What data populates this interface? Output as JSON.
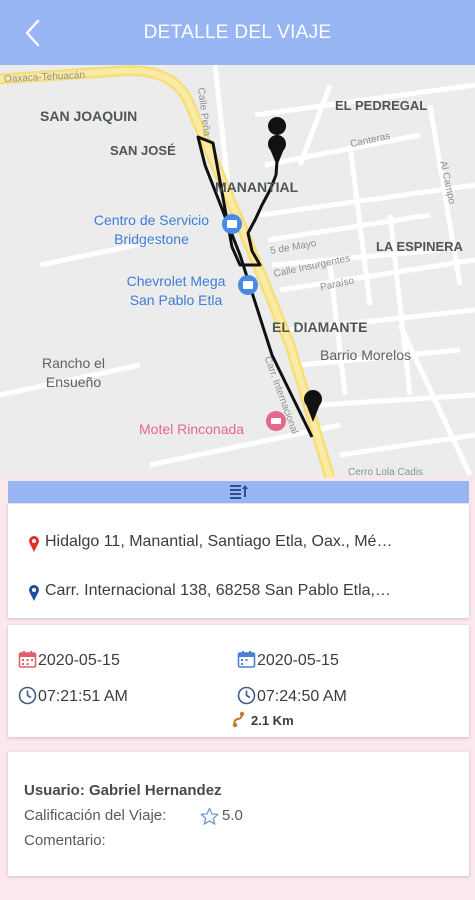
{
  "header": {
    "title": "DETALLE DEL VIAJE"
  },
  "map": {
    "areas": [
      "SAN JOAQUIN",
      "SAN JOSÉ",
      "EL PEDREGAL",
      "MANANTIAL",
      "LA ESPINERA",
      "EL DIAMANTE"
    ],
    "places": {
      "bridgestone": [
        "Centro de Servicio",
        "Bridgestone"
      ],
      "chevrolet": [
        "Chevrolet Mega",
        "San Pablo Etla"
      ],
      "rancho": [
        "Rancho el",
        "Ensueño"
      ],
      "barrio": "Barrio Morelos",
      "motel": "Motel Rinconada"
    },
    "streets": [
      "Oaxaca-Tehuacán",
      "Calle Peña",
      "Canteras",
      "Al Campo",
      "5 de Mayo",
      "Calle Insurgentes",
      "Paraíso",
      "Carr. Internacional",
      "Cerro Lola Cadis"
    ]
  },
  "trip": {
    "origin": "Hidalgo 11, Manantial, Santiago Etla, Oax., Mé…",
    "destination": "Carr. Internacional 138, 68258 San Pablo Etla,…",
    "start_date": "2020-05-15",
    "end_date": "2020-05-15",
    "start_time": "07:21:51 AM",
    "end_time": "07:24:50 AM",
    "distance": "2.1 Km"
  },
  "user": {
    "name": "Usuario: Gabriel Hernandez",
    "rating_label": "Calificación del Viaje:",
    "rating": "5.0",
    "comment_label": "Comentario:"
  },
  "colors": {
    "header": "#98b6f3",
    "background": "#fbe7ec",
    "origin_pin": "#e0302a",
    "destination_pin": "#1f4f9e",
    "calendar_start": "#e45b6a",
    "calendar_end": "#4a7fd4"
  }
}
